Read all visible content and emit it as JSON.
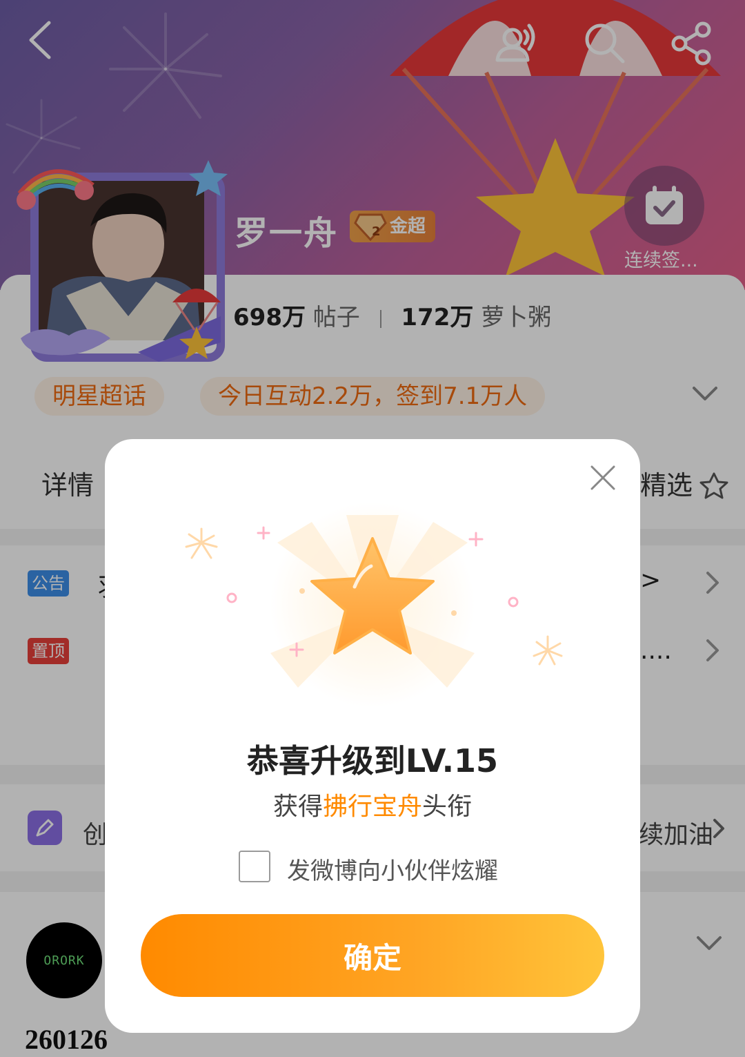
{
  "header": {
    "user_name": "罗一舟",
    "badge_label": "金超",
    "checkin_label": "连续签..."
  },
  "stats": {
    "posts_count": "698万",
    "posts_label": "帖子",
    "fans_count": "172万",
    "fans_label": "萝卜粥"
  },
  "chips": {
    "category": "明星超话",
    "activity": "今日互动2.2万，签到7.1万人"
  },
  "tabs": {
    "left_label": "详情",
    "right_label": "精选"
  },
  "rows": {
    "notice_tag": "公告",
    "notice_text": "羽",
    "notice_suffix": ">",
    "pinned_tag": "置顶",
    "pinned_suffix": "....",
    "create_left": "创",
    "create_right": "续加油"
  },
  "post": {
    "avatar_text": "ORORK",
    "number": "260126"
  },
  "dialog": {
    "title": "恭喜升级到LV.15",
    "subtitle_prefix": "获得",
    "subtitle_highlight": "拂行宝舟",
    "subtitle_suffix": "头衔",
    "share_label": "发微博向小伙伴炫耀",
    "confirm_label": "确定",
    "share_checked": false
  },
  "colors": {
    "accent_orange": "#ff8a00",
    "tag_blue": "#3d8ee8",
    "tag_red": "#e8403a"
  }
}
